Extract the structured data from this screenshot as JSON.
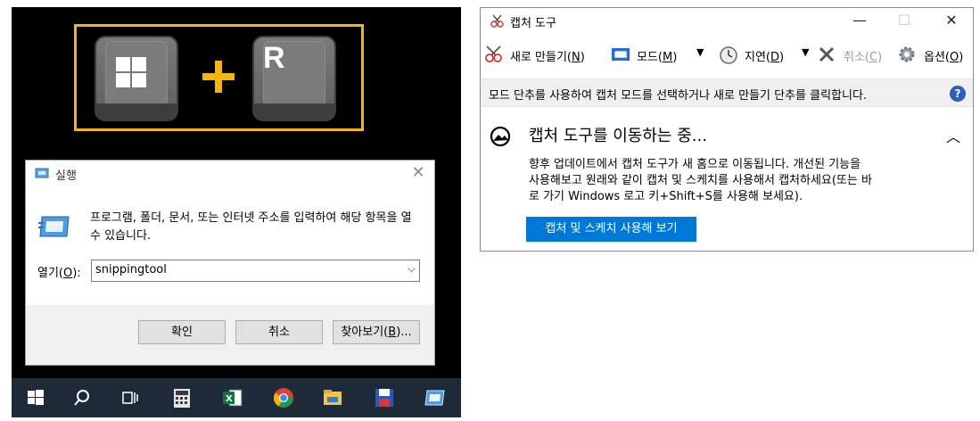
{
  "run_dialog": {
    "title": "실행",
    "description": "프로그램, 폴더, 문서, 또는 인터넷 주소를 입력하여 해당 항목을 열 수 있습니다.",
    "open_label_prefix": "열기(",
    "open_label_key": "O",
    "open_label_suffix": "):",
    "open_value": "snippingtool",
    "buttons": {
      "ok": "확인",
      "cancel": "취소",
      "browse_prefix": "찾아보기(",
      "browse_key": "B",
      "browse_suffix": ")..."
    }
  },
  "keyboard_hint": {
    "key_left": "win-logo",
    "plus": "+",
    "key_right": "R"
  },
  "taskbar": {
    "icons": [
      "windows-start-icon",
      "search-icon",
      "task-view-icon",
      "calculator-icon",
      "excel-icon",
      "chrome-icon",
      "file-explorer-icon",
      "save-disk-icon",
      "run-app-icon"
    ]
  },
  "snipping_tool": {
    "title": "캡처 도구",
    "window_controls": {
      "minimize": "—",
      "maximize": "☐",
      "close": "✕"
    },
    "toolbar": {
      "new": {
        "label": "새로 만들기(",
        "key": "N",
        "suffix": ")"
      },
      "mode": {
        "label": "모드(",
        "key": "M",
        "suffix": ")"
      },
      "delay": {
        "label": "지연(",
        "key": "D",
        "suffix": ")"
      },
      "cancel": {
        "label": "취소(",
        "key": "C",
        "suffix": ")"
      },
      "options": {
        "label": "옵션(",
        "key": "O",
        "suffix": ")"
      }
    },
    "info_text": "모드 단추를 사용하여 캡처 모드를 선택하거나 새로 만들기 단추를 클릭합니다.",
    "moving": {
      "heading": "캡처 도구를 이동하는 중...",
      "body_line1": "향후 업데이트에서 캡처 도구가 새 홈으로 이동됩니다. 개선된 기능을",
      "body_line2": "사용해보고 원래와 같이 캡처 및 스케치를 사용해서 캡처하세요(또는 바",
      "body_line3": "로 가기 Windows 로고 키+Shift+S를 사용해 보세요).",
      "button": "캡처 및 스케치 사용해 보기"
    }
  },
  "colors": {
    "accent_blue": "#0078d7",
    "key_border": "#f2b511",
    "taskbar": "#1f2a38"
  }
}
